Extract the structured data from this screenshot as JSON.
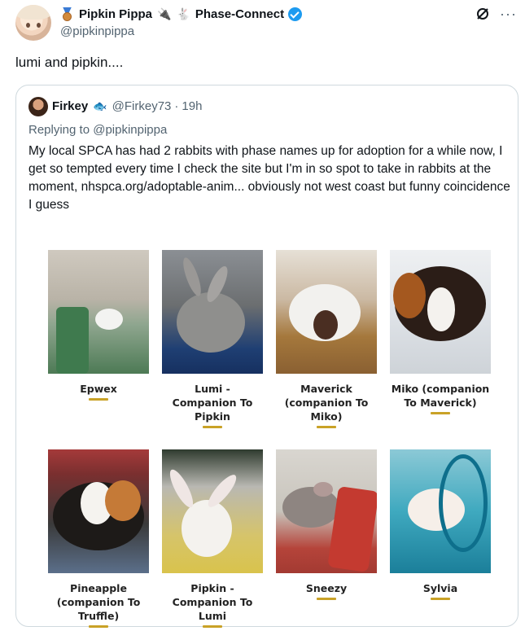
{
  "author": {
    "display_name": "Pipkin Pippa",
    "name_suffix": "Phase-Connect",
    "handle": "@pipkinpippa"
  },
  "icons": [
    "medal-icon",
    "plug-icon",
    "rabbit-icon",
    "verified-badge-icon",
    "grok-slash-icon",
    "more-icon"
  ],
  "tweet": {
    "text": "lumi and pipkin...."
  },
  "quote": {
    "author_name": "Firkey",
    "author_emoji": "fish",
    "handle": "@Firkey73",
    "separator": "·",
    "time": "19h",
    "replying_to": "Replying to @pipkinpippa",
    "text": "My local SPCA has had 2 rabbits with phase names up for adoption for a while now, I get so tempted every time I check the site but I'm in so spot to take in rabbits at the moment, nhspca.org/adoptable-anim... obviously not west coast but funny coincidence I guess",
    "pets": [
      {
        "name": "Epwex"
      },
      {
        "name": "Lumi - Companion To Pipkin"
      },
      {
        "name": "Maverick (companion To Miko)"
      },
      {
        "name": "Miko (companion To Maverick)"
      },
      {
        "name": "Pineapple (companion To Truffle)"
      },
      {
        "name": "Pipkin - Companion To Lumi"
      },
      {
        "name": "Sneezy"
      },
      {
        "name": "Sylvia"
      }
    ]
  },
  "colors": {
    "text": "#0f1419",
    "muted": "#536471",
    "verified": "#1d9bf0",
    "border": "#cfd9de",
    "accent_line": "#c9a227"
  }
}
